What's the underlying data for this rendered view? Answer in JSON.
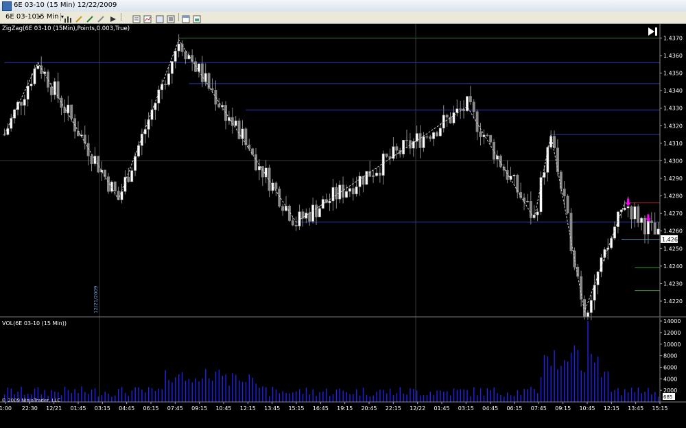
{
  "window": {
    "title": "6E 03-10 (15 Min)  12/22/2009"
  },
  "toolbar": {
    "instrument": "6E 03-10",
    "interval": "15 Min",
    "icons": [
      "bar-chart-icon",
      "pencil-icon",
      "draw-tool-icon",
      "strategy-icon",
      "arrow-icon",
      "properties-icon",
      "indicators-icon",
      "zoom-icon",
      "crosshair-icon",
      "tabs-icon",
      "chart-trader-icon"
    ]
  },
  "price_panel": {
    "indicator_label": "ZigZag(6E 03-10 (15Min),Points,0.003,True)",
    "current_price": "1.4263",
    "left_vertical_text": "12/21/2009"
  },
  "volume_panel": {
    "indicator_label": "VOL(6E 03-10 (15 Min))",
    "copyright": "© 2009 NinjaTrader, LLC",
    "last_volume": "685"
  },
  "chart_data": [
    {
      "type": "candlestick",
      "name": "price",
      "ylim": [
        1.4211,
        1.4378
      ],
      "y_ticks": [
        "1.4370",
        "1.4360",
        "1.4350",
        "1.4340",
        "1.4330",
        "1.4320",
        "1.4310",
        "1.4300",
        "1.4290",
        "1.4280",
        "1.4270",
        "1.4260",
        "1.4250",
        "1.4240",
        "1.4230",
        "1.4220"
      ],
      "x_ticks": [
        "1:00",
        "22:30",
        "12/21",
        "01:45",
        "03:15",
        "04:45",
        "06:15",
        "07:45",
        "09:15",
        "10:45",
        "12:15",
        "13:45",
        "15:15",
        "16:45",
        "19:15",
        "20:45",
        "22:15",
        "12/22",
        "01:45",
        "03:15",
        "04:45",
        "06:15",
        "07:45",
        "09:15",
        "10:45",
        "12:15",
        "13:45",
        "15:15"
      ],
      "zigzag": [
        {
          "bar": 0,
          "y": 1.4315
        },
        {
          "bar": 10,
          "y": 1.4356
        },
        {
          "bar": 34,
          "y": 1.4278
        },
        {
          "bar": 52,
          "y": 1.4369
        },
        {
          "bar": 87,
          "y": 1.4265
        },
        {
          "bar": 138,
          "y": 1.4331
        },
        {
          "bar": 158,
          "y": 1.4267
        },
        {
          "bar": 163,
          "y": 1.4315
        },
        {
          "bar": 173,
          "y": 1.4214
        },
        {
          "bar": 185,
          "y": 1.4276
        }
      ],
      "horizontal_lines": [
        {
          "y": 1.437,
          "color": "#2f7d2f",
          "from_bar": 52
        },
        {
          "y": 1.4356,
          "color": "#2a3ab0",
          "from_bar": 0
        },
        {
          "y": 1.4344,
          "color": "#2a3ab0",
          "from_bar": 55
        },
        {
          "y": 1.4329,
          "color": "#2a3ab0",
          "from_bar": 72
        },
        {
          "y": 1.4315,
          "color": "#2a3ab0",
          "from_bar": 163
        },
        {
          "y": 1.4276,
          "color": "#aa1f1f",
          "from_bar": 185
        },
        {
          "y": 1.4265,
          "color": "#2a3ab0",
          "from_bar": 87
        },
        {
          "y": 1.4255,
          "color": "#2a80a0",
          "from_bar": 184
        },
        {
          "y": 1.4239,
          "color": "#2f9a2f",
          "from_bar": 188
        },
        {
          "y": 1.4226,
          "color": "#2f9a2f",
          "from_bar": 188
        }
      ],
      "markers": [
        {
          "bar": 186,
          "y": 1.4275,
          "color": "#ff00ff"
        },
        {
          "bar": 192,
          "y": 1.4266,
          "color": "#ff00ff"
        }
      ]
    },
    {
      "type": "bar",
      "name": "volume",
      "ylim": [
        0,
        14600
      ],
      "y_ticks": [
        "14000",
        "12000",
        "10000",
        "8000",
        "6000",
        "4000",
        "2000"
      ]
    }
  ]
}
